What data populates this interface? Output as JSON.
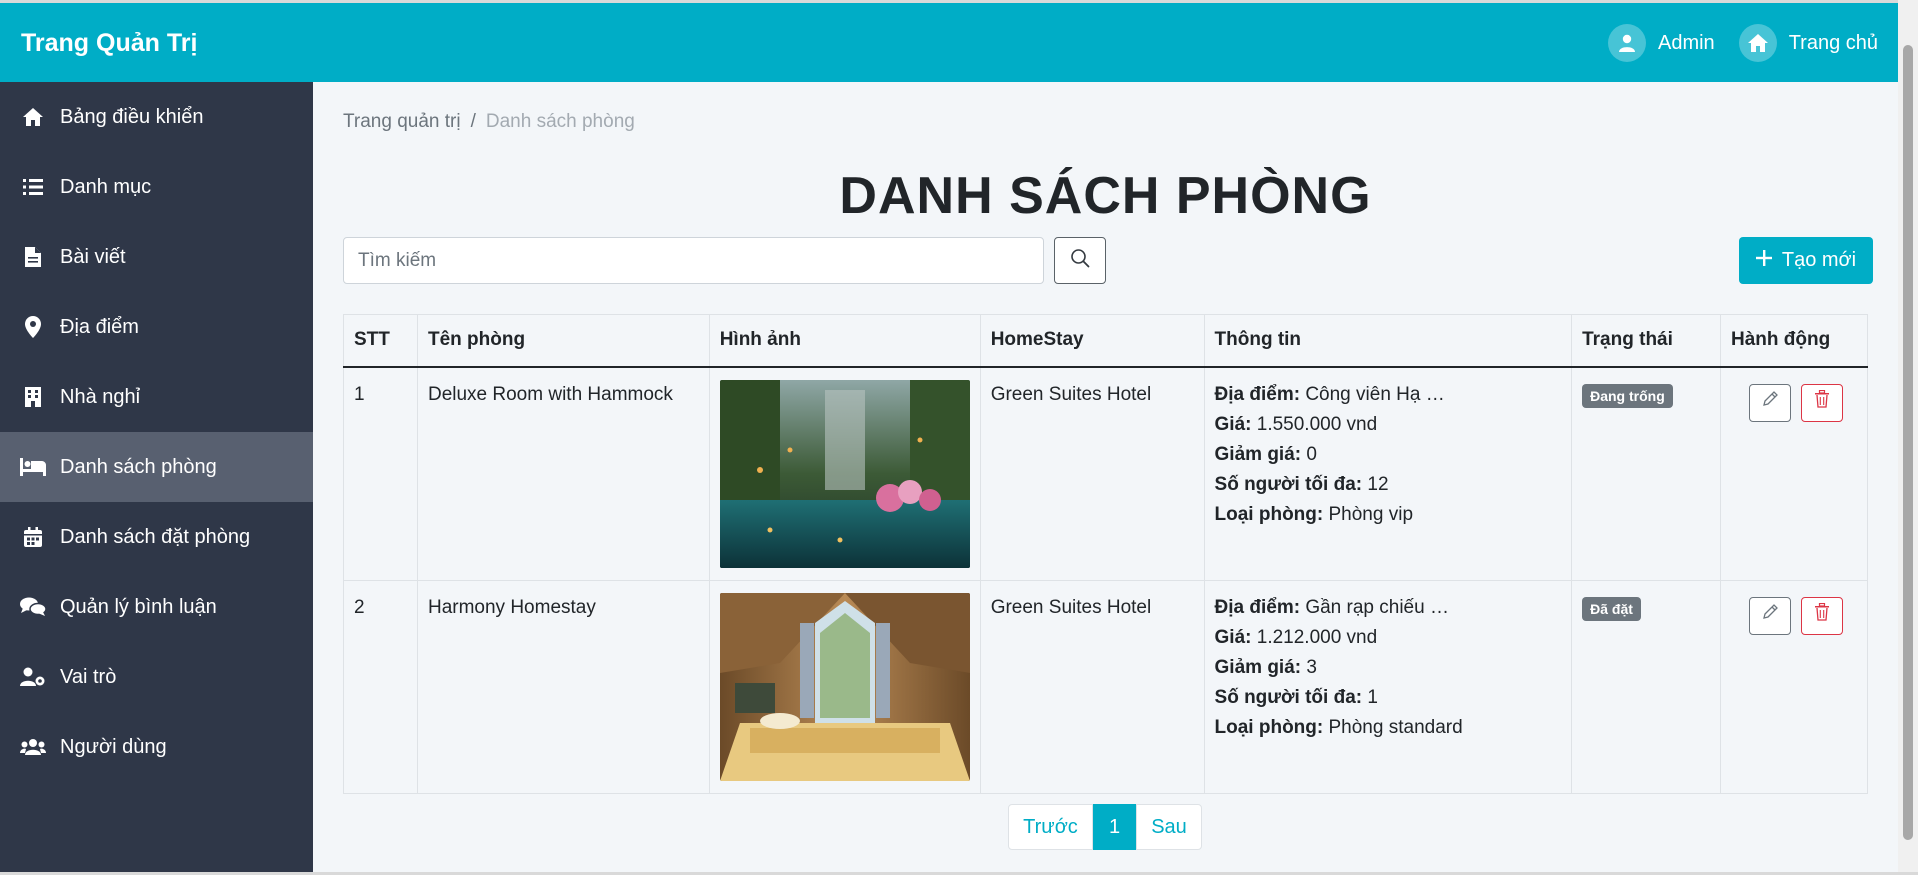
{
  "header": {
    "brand": "Trang Quản Trị",
    "user_label": "Admin",
    "home_label": "Trang chủ"
  },
  "sidebar": {
    "items": [
      {
        "label": "Bảng điều khiển",
        "icon": "home-icon"
      },
      {
        "label": "Danh mục",
        "icon": "list-icon"
      },
      {
        "label": "Bài viết",
        "icon": "file-icon"
      },
      {
        "label": "Địa điểm",
        "icon": "map-pin-icon"
      },
      {
        "label": "Nhà nghỉ",
        "icon": "building-icon"
      },
      {
        "label": "Danh sách phòng",
        "icon": "bed-icon",
        "active": true
      },
      {
        "label": "Danh sách đặt phòng",
        "icon": "calendar-icon"
      },
      {
        "label": "Quản lý bình luận",
        "icon": "comments-icon"
      },
      {
        "label": "Vai trò",
        "icon": "user-gear-icon"
      },
      {
        "label": "Người dùng",
        "icon": "users-icon"
      }
    ]
  },
  "breadcrumb": {
    "root": "Trang quản trị",
    "separator": "/",
    "current": "Danh sách phòng"
  },
  "page": {
    "title": "DANH SÁCH PHÒNG",
    "search_placeholder": "Tìm kiếm",
    "create_label": "Tạo mới"
  },
  "table": {
    "headers": [
      "STT",
      "Tên phòng",
      "Hình ảnh",
      "HomeStay",
      "Thông tin",
      "Trạng thái",
      "Hành động"
    ],
    "info_labels": {
      "location": "Địa điểm:",
      "price": "Giá:",
      "discount": "Giảm giá:",
      "max_people": "Số người tối đa:",
      "room_type": "Loại phòng:"
    },
    "rows": [
      {
        "stt": "1",
        "name": "Deluxe Room with Hammock",
        "image": "garden-pool-photo",
        "homestay": "Green Suites Hotel",
        "location": "Công viên Hạ …",
        "price": "1.550.000 vnd",
        "discount": "0",
        "max_people": "12",
        "room_type": "Phòng vip",
        "status": "Đang trống"
      },
      {
        "stt": "2",
        "name": "Harmony Homestay",
        "image": "wooden-bedroom-photo",
        "homestay": "Green Suites Hotel",
        "location": "Gần rạp chiếu …",
        "price": "1.212.000 vnd",
        "discount": "3",
        "max_people": "1",
        "room_type": "Phòng standard",
        "status": "Đã đặt"
      }
    ]
  },
  "pagination": {
    "prev": "Trước",
    "current": "1",
    "next": "Sau"
  },
  "colors": {
    "accent": "#00adc6",
    "sidebar_bg": "#2f3748",
    "sidebar_active": "#586070",
    "badge": "#6c757d",
    "danger": "#dc3545"
  }
}
